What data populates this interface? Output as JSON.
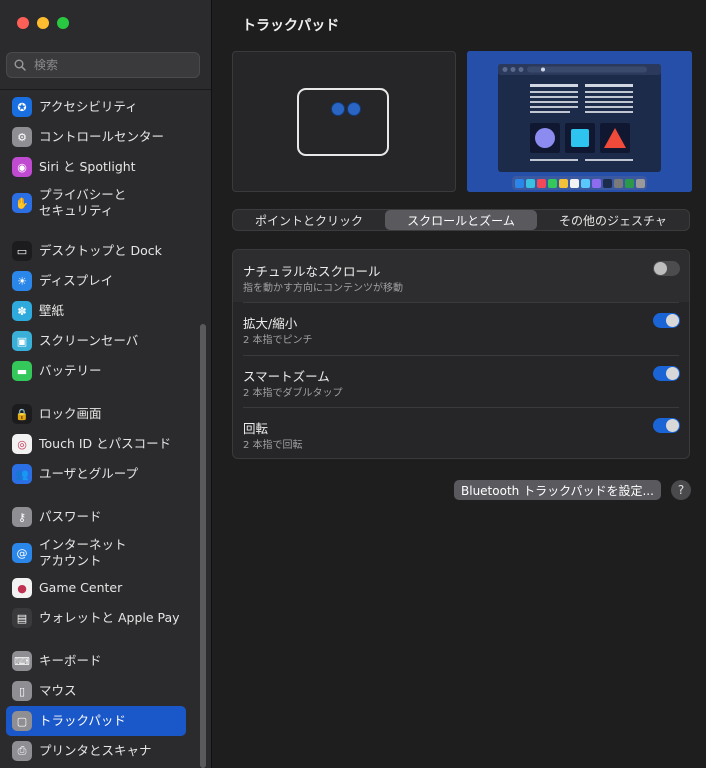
{
  "sidebar": {
    "search_placeholder": "検索",
    "items": [
      {
        "label": "アクセシビリティ",
        "icon": "accessibility-icon",
        "color": "#1a6fe0"
      },
      {
        "label": "コントロールセンター",
        "icon": "control-center-icon",
        "color": "#8e8e93"
      },
      {
        "label": "Siri と Spotlight",
        "icon": "siri-icon",
        "color": "#c04ad0"
      },
      {
        "label": "プライバシーと",
        "label2": "セキュリティ",
        "icon": "hand-icon",
        "color": "#2a6fe4"
      },
      {
        "label": "デスクトップと Dock",
        "icon": "desktop-dock-icon",
        "color": "#1c1c1e"
      },
      {
        "label": "ディスプレイ",
        "icon": "display-icon",
        "color": "#2a86e8"
      },
      {
        "label": "壁紙",
        "icon": "wallpaper-icon",
        "color": "#2eaadc"
      },
      {
        "label": "スクリーンセーバ",
        "icon": "screensaver-icon",
        "color": "#3ab0d8"
      },
      {
        "label": "バッテリー",
        "icon": "battery-icon",
        "color": "#34c759"
      },
      {
        "label": "ロック画面",
        "icon": "lock-icon",
        "color": "#1c1c1e"
      },
      {
        "label": "Touch ID とパスコード",
        "icon": "fingerprint-icon",
        "color": "#f2f2f2"
      },
      {
        "label": "ユーザとグループ",
        "icon": "users-icon",
        "color": "#2a6fe4"
      },
      {
        "label": "パスワード",
        "icon": "key-icon",
        "color": "#8e8e93"
      },
      {
        "label": "インターネット",
        "label2": "アカウント",
        "icon": "at-icon",
        "color": "#2a86e8"
      },
      {
        "label": "Game Center",
        "icon": "game-center-icon",
        "color": "#f2f2f2"
      },
      {
        "label": "ウォレットと Apple Pay",
        "icon": "wallet-icon",
        "color": "#3a3a3c"
      },
      {
        "label": "キーボード",
        "icon": "keyboard-icon",
        "color": "#8e8e93"
      },
      {
        "label": "マウス",
        "icon": "mouse-icon",
        "color": "#8e8e93"
      },
      {
        "label": "トラックパッド",
        "icon": "trackpad-icon",
        "color": "#8e8e93"
      },
      {
        "label": "プリンタとスキャナ",
        "icon": "printer-icon",
        "color": "#8e8e93"
      }
    ]
  },
  "main": {
    "title": "トラックパッド",
    "tabs": [
      {
        "label": "ポイントとクリック"
      },
      {
        "label": "スクロールとズーム",
        "selected": true
      },
      {
        "label": "その他のジェスチャ"
      }
    ],
    "settings": [
      {
        "title": "ナチュラルなスクロール",
        "subtitle": "指を動かす方向にコンテンツが移動",
        "on": false
      },
      {
        "title": "拡大/縮小",
        "subtitle": "2 本指でピンチ",
        "on": true
      },
      {
        "title": "スマートズーム",
        "subtitle": "2 本指でダブルタップ",
        "on": true
      },
      {
        "title": "回転",
        "subtitle": "2 本指で回転",
        "on": true
      }
    ],
    "bluetooth_button": "Bluetooth トラックパッドを設定...",
    "help_label": "?"
  },
  "colors": {
    "accent": "#1a57c8",
    "toggle_on": "#1a64d6",
    "preview_bg": "#2a58b8"
  }
}
